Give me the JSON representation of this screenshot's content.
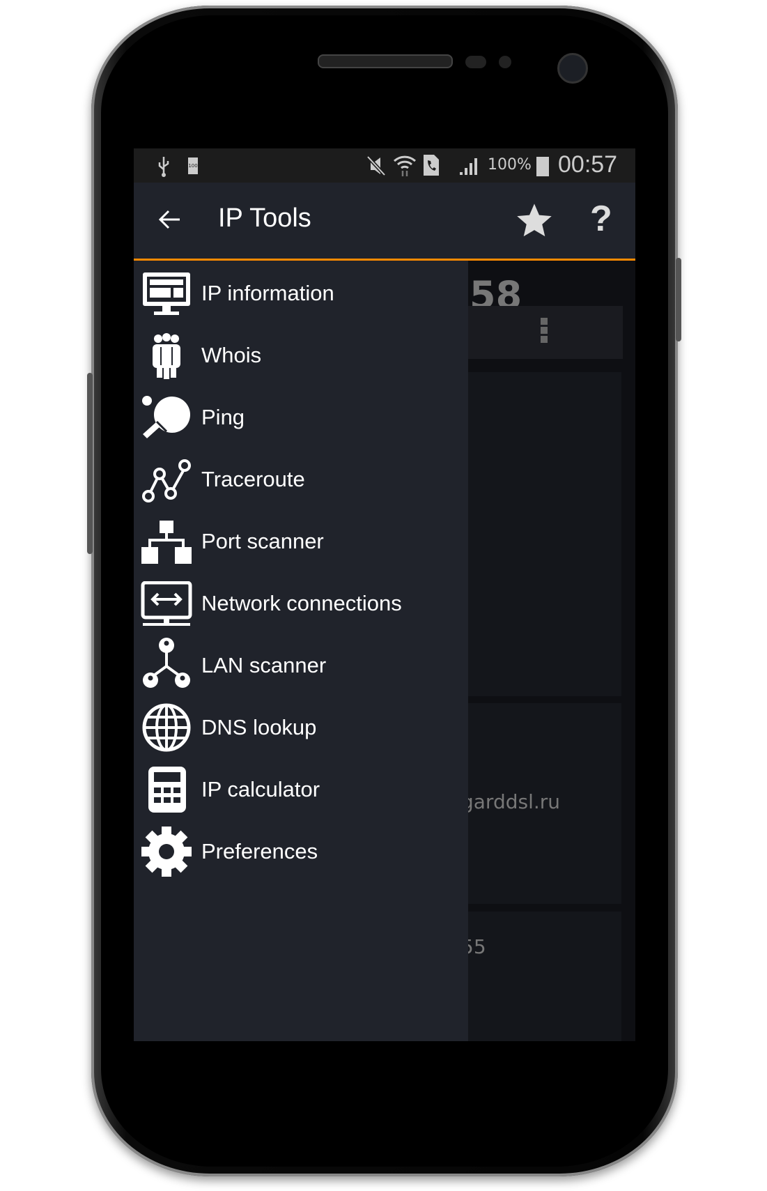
{
  "status_bar": {
    "battery_small": "100",
    "battery_percent": "100%",
    "time": "00:57",
    "icons": [
      "usb-icon",
      "battery-icon",
      "vibrate-icon",
      "wifi-icon",
      "phone-icon",
      "signal-icon",
      "battery-full-icon"
    ]
  },
  "app_bar": {
    "title": "IP Tools",
    "back_icon": "arrow-left-icon",
    "favorite_icon": "star-icon",
    "help_label": "?"
  },
  "background": {
    "big_number": "58",
    "menu_icon": "more-vert-icon",
    "host": "garddsl.ru",
    "bottom_value": "55"
  },
  "drawer": {
    "items": [
      {
        "label": "IP information",
        "icon": "monitor-icon"
      },
      {
        "label": "Whois",
        "icon": "people-icon"
      },
      {
        "label": "Ping",
        "icon": "ping-pong-icon"
      },
      {
        "label": "Traceroute",
        "icon": "route-icon"
      },
      {
        "label": "Port scanner",
        "icon": "hierarchy-icon"
      },
      {
        "label": "Network connections",
        "icon": "network-monitor-icon"
      },
      {
        "label": "LAN scanner",
        "icon": "lan-icon"
      },
      {
        "label": "DNS lookup",
        "icon": "globe-icon"
      },
      {
        "label": "IP calculator",
        "icon": "calculator-icon"
      },
      {
        "label": "Preferences",
        "icon": "gear-icon"
      }
    ]
  },
  "colors": {
    "accent": "#ff8a00",
    "appbar": "#20232b",
    "drawer": "#20232b"
  }
}
